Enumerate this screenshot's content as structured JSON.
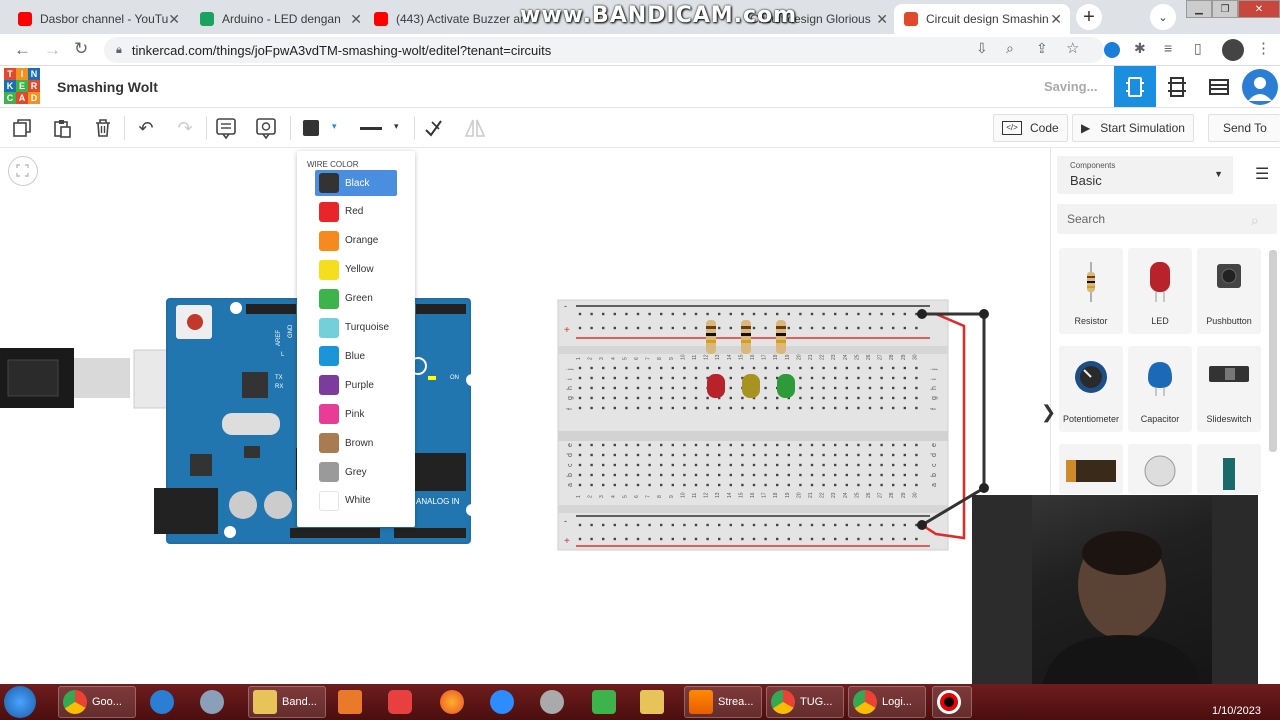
{
  "overlay": {
    "recorder": "www.BANDICAM.com"
  },
  "browser": {
    "tabs": [
      {
        "label": "Dasbor channel - YouTu",
        "color": "#ff0000"
      },
      {
        "label": "Arduino - LED dengan",
        "color": "#1aa260"
      },
      {
        "label": "(443) Activate Buzzer ar",
        "color": "#ff0000"
      },
      {
        "label": "Circuit design Glorious",
        "color": "#e04a2a"
      },
      {
        "label": "Circuit design Smashin",
        "color": "#e04a2a"
      }
    ],
    "url": "tinkercad.com/things/joFpwA3vdTM-smashing-wolt/editel?tenant=circuits"
  },
  "tinkercad": {
    "logo": [
      "TIN",
      "KER",
      "CAD"
    ],
    "design_name": "Smashing Wolt",
    "status": "Saving...",
    "toolbar": {
      "code_label": "Code",
      "simulate_label": "Start Simulation",
      "send_label": "Send To"
    }
  },
  "wire_color_menu": {
    "header": "WIRE COLOR",
    "options": [
      {
        "label": "Black",
        "color": "#333333"
      },
      {
        "label": "Red",
        "color": "#e8262a"
      },
      {
        "label": "Orange",
        "color": "#f58a1f"
      },
      {
        "label": "Yellow",
        "color": "#f5de1c"
      },
      {
        "label": "Green",
        "color": "#3cb44b"
      },
      {
        "label": "Turquoise",
        "color": "#74d0d8"
      },
      {
        "label": "Blue",
        "color": "#1a96d8"
      },
      {
        "label": "Purple",
        "color": "#7c3c9c"
      },
      {
        "label": "Pink",
        "color": "#e83c96"
      },
      {
        "label": "Brown",
        "color": "#a87c50"
      },
      {
        "label": "Grey",
        "color": "#9a9a9a"
      },
      {
        "label": "White",
        "color": "#ffffff"
      }
    ],
    "selected": "Black"
  },
  "components": {
    "small_label": "Components",
    "category": "Basic",
    "search_placeholder": "Search",
    "items": [
      {
        "label": "Resistor"
      },
      {
        "label": "LED"
      },
      {
        "label": "Pushbutton"
      },
      {
        "label": "Potentiometer"
      },
      {
        "label": "Capacitor"
      },
      {
        "label": "Slideswitch"
      }
    ]
  },
  "arduino": {
    "labels": [
      "AREF",
      "GND",
      "TX",
      "RX",
      "ON",
      "ANALOG IN",
      "L"
    ]
  },
  "breadboard": {
    "columns_top": [
      "1",
      "2",
      "3",
      "4",
      "5",
      "6",
      "7",
      "8",
      "9",
      "10",
      "11",
      "12",
      "13",
      "14",
      "15",
      "16",
      "17",
      "18",
      "19",
      "20",
      "21",
      "22",
      "23",
      "24",
      "25",
      "26",
      "27",
      "28",
      "29",
      "30"
    ],
    "rows_top": [
      "j",
      "i",
      "h",
      "g",
      "f"
    ],
    "rows_bottom": [
      "e",
      "d",
      "c",
      "b",
      "a"
    ],
    "plus": "+",
    "minus": "-"
  },
  "taskbar": {
    "items": [
      {
        "label": "Goo..."
      },
      {
        "label": "Band..."
      },
      {
        "label": "Strea..."
      },
      {
        "label": "TUG..."
      },
      {
        "label": "Logi..."
      }
    ],
    "date": "1/10/2023"
  }
}
